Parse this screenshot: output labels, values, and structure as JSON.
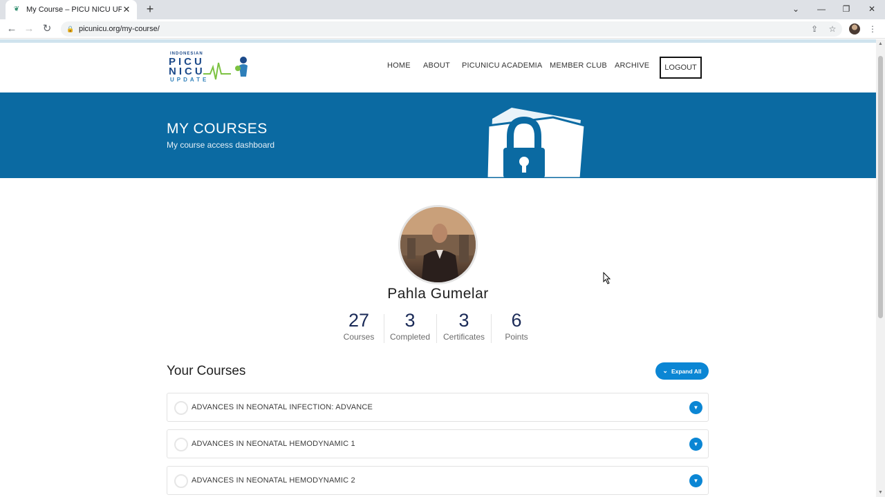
{
  "browser": {
    "tab_title": "My Course – PICU NICU UPDATE",
    "url": "picunicu.org/my-course/"
  },
  "site": {
    "logo": {
      "small": "INDONESIAN",
      "line1": "PICU",
      "line2": "NICU",
      "line3": "UPDATE"
    },
    "nav": [
      "HOME",
      "ABOUT",
      "PICUNICU ACADEMIA",
      "MEMBER CLUB",
      "ARCHIVE"
    ],
    "logout_label": "LOGOUT"
  },
  "banner": {
    "title": "MY COURSES",
    "subtitle": "My course access dashboard"
  },
  "profile": {
    "name": "Pahla Gumelar",
    "stats": [
      {
        "value": "27",
        "label": "Courses"
      },
      {
        "value": "3",
        "label": "Completed"
      },
      {
        "value": "3",
        "label": "Certificates"
      },
      {
        "value": "6",
        "label": "Points"
      }
    ]
  },
  "courses": {
    "heading": "Your Courses",
    "expand_label": "Expand All",
    "items": [
      "ADVANCES IN NEONATAL INFECTION: ADVANCE",
      "ADVANCES IN NEONATAL HEMODYNAMIC 1",
      "ADVANCES IN NEONATAL HEMODYNAMIC 2"
    ]
  },
  "colors": {
    "banner": "#0b6aa2",
    "accent": "#0b86d4",
    "stat_number": "#1a2a57"
  }
}
